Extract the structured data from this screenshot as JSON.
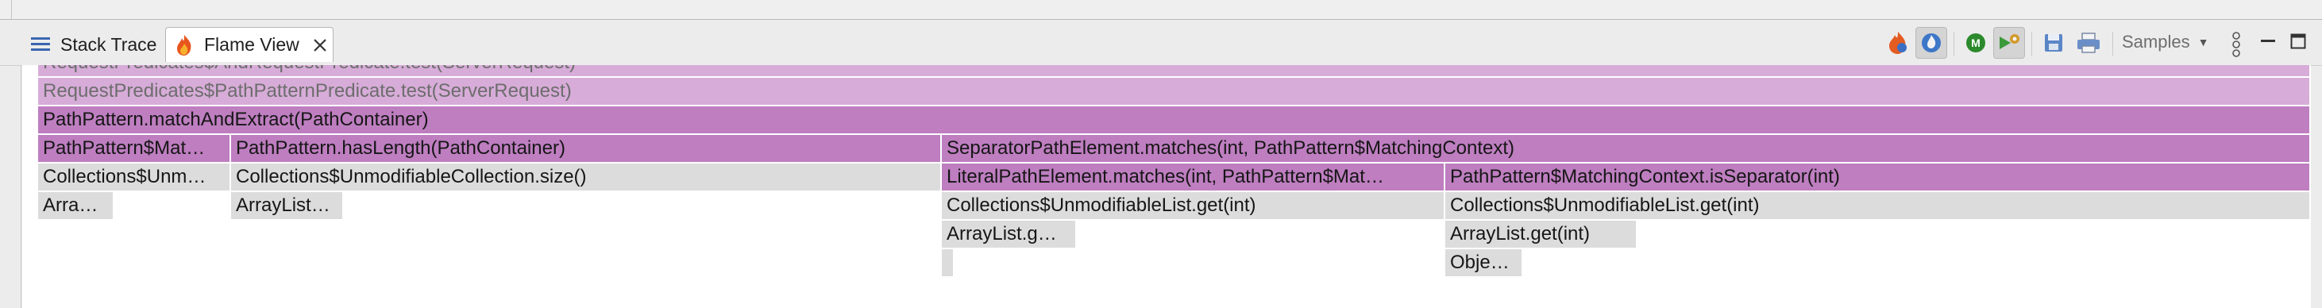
{
  "tabs": [
    {
      "label": "Stack Trace",
      "icon": "list-icon",
      "active": false
    },
    {
      "label": "Flame View",
      "icon": "flame-icon",
      "active": true
    }
  ],
  "toolbar": {
    "samples_label": "Samples",
    "icons": [
      "flame-graph-icon",
      "icicle-graph-icon",
      "method-badge-icon",
      "run-gear-icon",
      "save-icon",
      "print-icon",
      "overflow-menu-icon",
      "minimize-icon",
      "maximize-icon"
    ]
  },
  "flame": {
    "rows": [
      [
        "RequestPredicates$AndRequestPredicate.test(ServerRequest)"
      ],
      [
        "RequestPredicates$PathPatternPredicate.test(ServerRequest)"
      ],
      [
        "PathPattern.matchAndExtract(PathContainer)"
      ],
      [
        "PathPattern$Mat…",
        "PathPattern.hasLength(PathContainer)",
        "SeparatorPathElement.matches(int, PathPattern$MatchingContext)"
      ],
      [
        "Collections$Unm…",
        "Collections$UnmodifiableCollection.size()",
        "LiteralPathElement.matches(int, PathPattern$Mat…",
        "PathPattern$MatchingContext.isSeparator(int)"
      ],
      [
        "Arra…",
        "ArrayList…",
        "Collections$UnmodifiableList.get(int)",
        "Collections$UnmodifiableList.get(int)"
      ],
      [
        "ArrayList.g…",
        "ArrayList.get(int)"
      ],
      [
        "",
        "Obje…"
      ]
    ]
  },
  "colors": {
    "lavender": "#d7acd8",
    "purple": "#be7ec0",
    "gray": "#dcdcdc"
  }
}
